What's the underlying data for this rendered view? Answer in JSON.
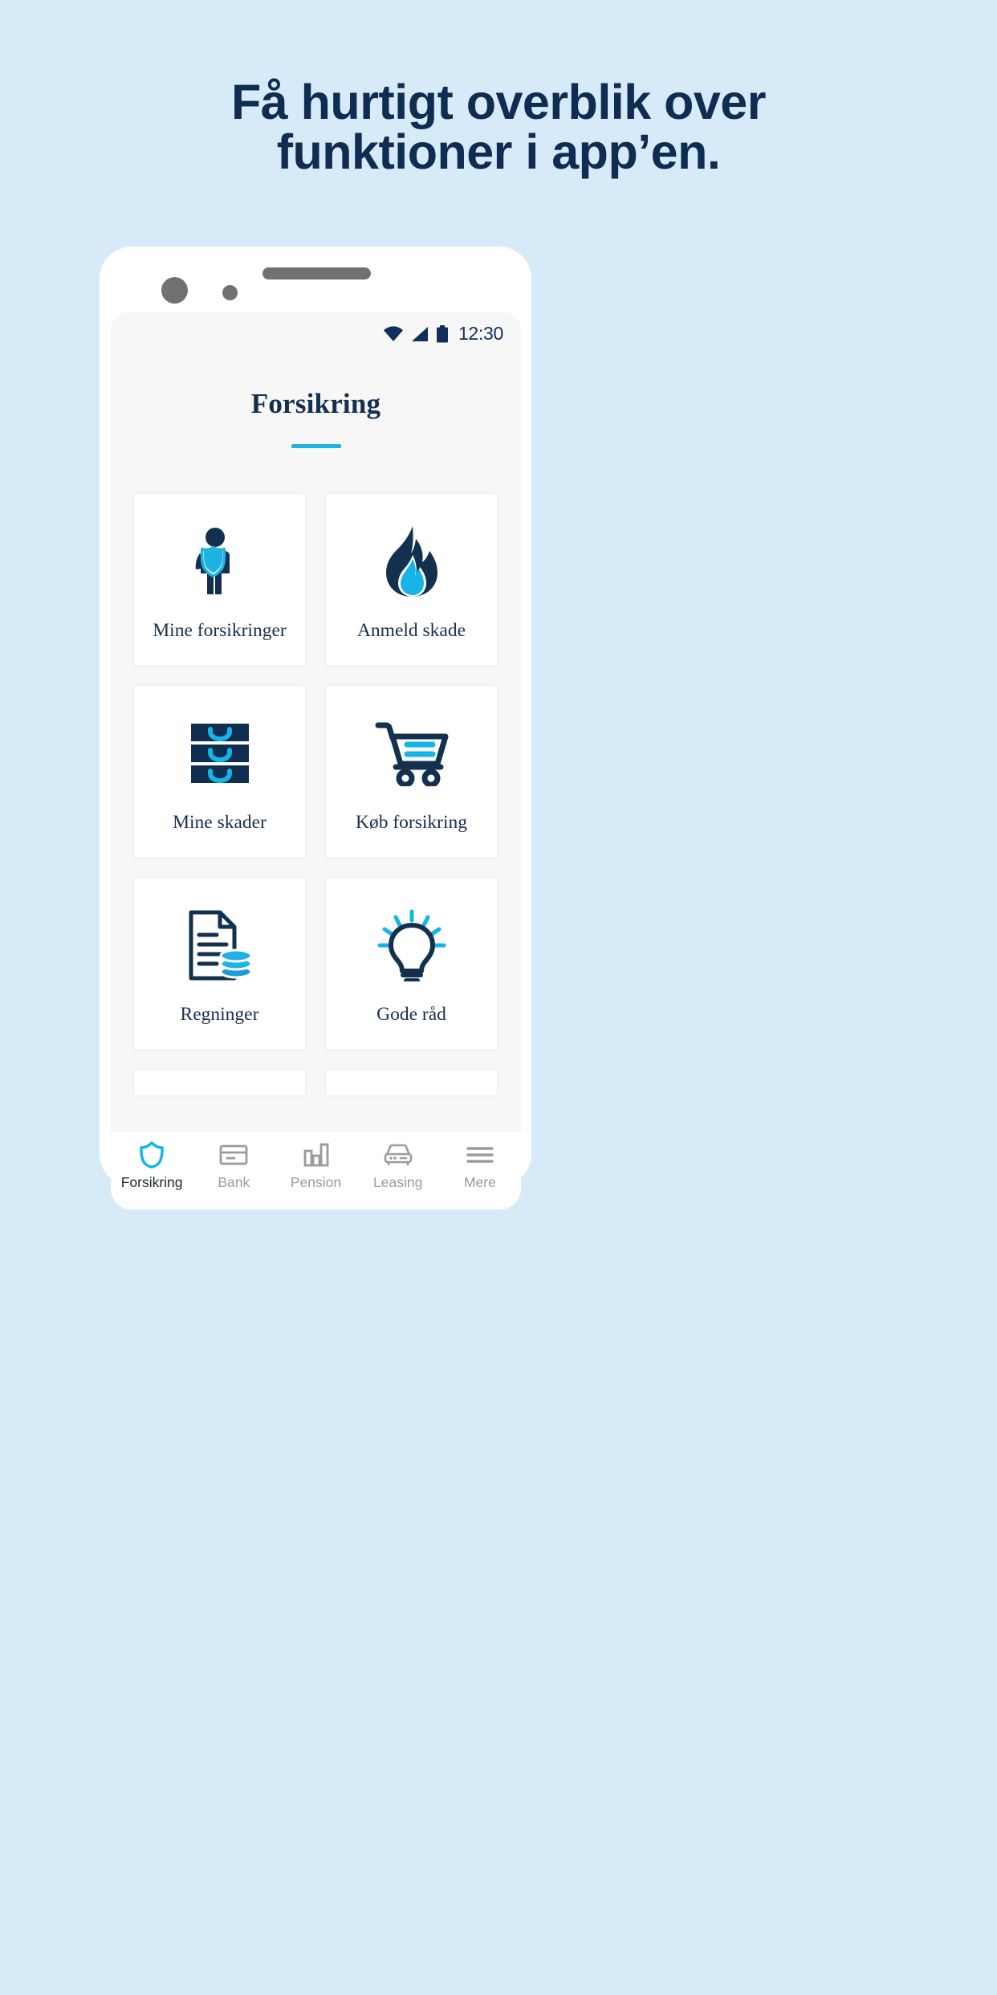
{
  "page": {
    "background_color": "#d6eaf8",
    "headline": {
      "line1": "Få hurtigt overblik over",
      "line2": "funktioner i app’en.",
      "color": "#0f2d52"
    }
  },
  "colors": {
    "brand_navy": "#14304f",
    "brand_cyan": "#1eb2e3",
    "page_bg": "#d6eaf8",
    "screen_bg": "#f7f7f7",
    "card_bg": "#ffffff",
    "nav_inactive": "#9b9b9b"
  },
  "phone": {
    "camera_large": "camera-lens",
    "camera_small": "sensor-dot",
    "speaker": "earpiece-speaker",
    "home_indicator": "home-indicator"
  },
  "status_bar": {
    "wifi_icon": "wifi-icon",
    "signal_icon": "cellular-signal-icon",
    "battery_icon": "battery-icon",
    "time": "12:30"
  },
  "app": {
    "title": "Forsikring",
    "title_underline": "title-underline-accent"
  },
  "cards": [
    {
      "label": "Mine forsikringer",
      "icon": "person-shield-icon"
    },
    {
      "label": "Anmeld skade",
      "icon": "flame-icon"
    },
    {
      "label": "Mine skader",
      "icon": "file-cabinet-icon"
    },
    {
      "label": "Køb forsikring",
      "icon": "shopping-cart-icon"
    },
    {
      "label": "Regninger",
      "icon": "document-coins-icon"
    },
    {
      "label": "Gode råd",
      "icon": "lightbulb-icon"
    }
  ],
  "bottom_nav": {
    "active": "Forsikring",
    "items": [
      {
        "label": "Forsikring",
        "icon": "shield-icon",
        "active": true
      },
      {
        "label": "Bank",
        "icon": "credit-card-icon",
        "active": false
      },
      {
        "label": "Pension",
        "icon": "bar-chart-icon",
        "active": false
      },
      {
        "label": "Leasing",
        "icon": "car-icon",
        "active": false
      },
      {
        "label": "Mere",
        "icon": "hamburger-menu-icon",
        "active": false
      }
    ]
  }
}
